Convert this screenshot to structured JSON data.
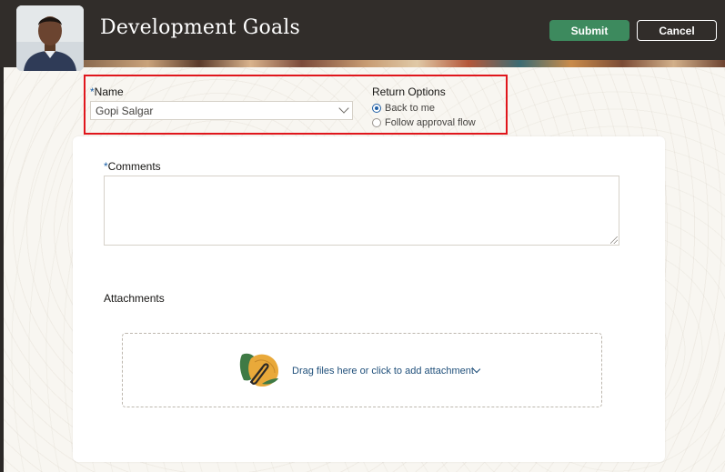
{
  "header": {
    "title": "Development Goals",
    "submit_label": "Submit",
    "cancel_label": "Cancel"
  },
  "form": {
    "name_label": "Name",
    "name_required_marker": "*",
    "name_value": "Gopi Salgar",
    "return_options_label": "Return Options",
    "return_options": [
      {
        "label": "Back to me",
        "selected": true
      },
      {
        "label": "Follow approval flow",
        "selected": false
      }
    ],
    "comments_label": "Comments",
    "comments_required_marker": "*",
    "comments_value": "",
    "attachments_label": "Attachments",
    "attachment_prompt": "Drag files here or click to add attachment"
  },
  "colors": {
    "header_bg": "#312d2a",
    "submit_bg": "#3d8a5e",
    "highlight": "#e0161c",
    "link": "#1f4f7a"
  },
  "icons": [
    "avatar",
    "chevron-down-icon",
    "attachment-paperclip-icon"
  ]
}
